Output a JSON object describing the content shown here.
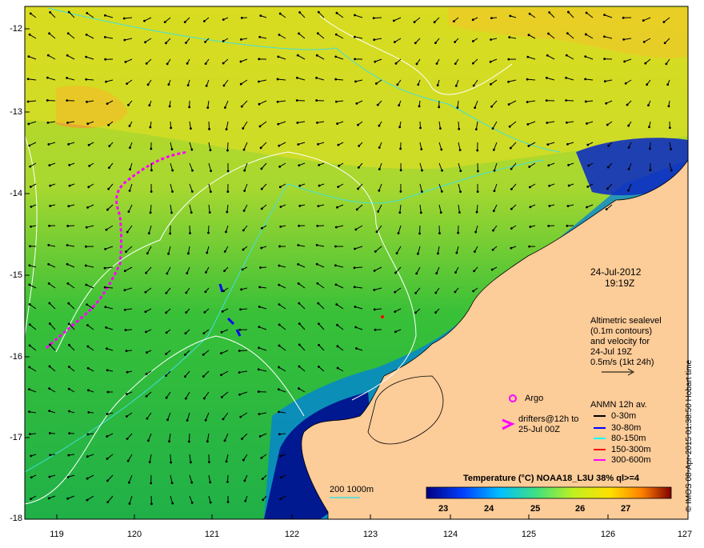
{
  "date": "24-Jul-2012",
  "time": "19:19Z",
  "altimetry_note": [
    "Altimetric sealevel",
    "(0.1m contours)",
    "and velocity for",
    "24-Jul 19Z",
    "0.5m/s (1kt 24h)"
  ],
  "argo_label": "Argo",
  "drifters_label": [
    "drifters@12h to",
    "25-Jul 00Z"
  ],
  "anmn_title": "ANMN 12h av.",
  "anmn_depths": [
    {
      "label": "0-30m",
      "color": "#000000"
    },
    {
      "label": "30-80m",
      "color": "#0000ff"
    },
    {
      "label": "80-150m",
      "color": "#00ffff"
    },
    {
      "label": "150-300m",
      "color": "#ff0000"
    },
    {
      "label": "300-600m",
      "color": "#ff00ff"
    }
  ],
  "isobath_label": "200  1000m",
  "colorbar_title": "Temperature (°C) NOAA18_L3U 38% ql>=4",
  "colorbar_ticks": [
    "23",
    "24",
    "25",
    "26",
    "27"
  ],
  "lat_labels": [
    "-12",
    "-13",
    "-14",
    "-15",
    "-16",
    "-17",
    "-18"
  ],
  "lon_labels": [
    "119",
    "120",
    "121",
    "122",
    "123",
    "124",
    "125",
    "126",
    "127"
  ],
  "credit": "© IMOS 08-Apr-2015 01:38:50 Hobart time",
  "colors": {
    "land": "#fccc99",
    "warm": "#e8d020",
    "mid": "#2fbe3c",
    "cool": "#0020a0",
    "isobath": "#40e0e0"
  }
}
